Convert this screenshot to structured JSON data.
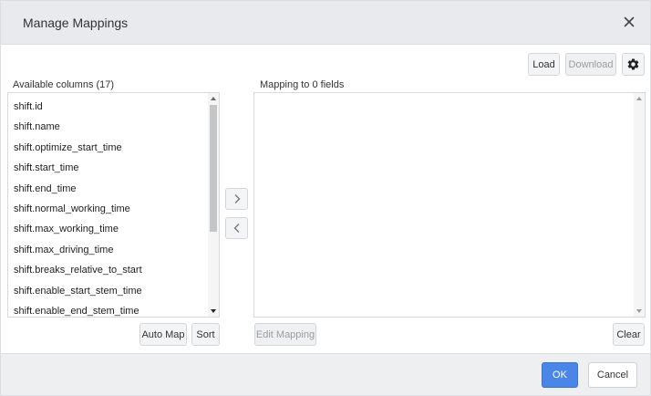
{
  "dialog": {
    "title": "Manage Mappings",
    "close_icon": "close-icon"
  },
  "toolbar": {
    "load_label": "Load",
    "download_label": "Download",
    "settings_icon": "gear-icon"
  },
  "available": {
    "label": "Available columns (17)",
    "items": [
      "shift.id",
      "shift.name",
      "shift.optimize_start_time",
      "shift.start_time",
      "shift.end_time",
      "shift.normal_working_time",
      "shift.max_working_time",
      "shift.max_driving_time",
      "shift.breaks_relative_to_start",
      "shift.enable_start_stem_time",
      "shift.enable_end_stem_time"
    ],
    "auto_map_label": "Auto Map",
    "sort_label": "Sort"
  },
  "transfer": {
    "add_icon": "chevron-right-icon",
    "remove_icon": "chevron-left-icon"
  },
  "mapping": {
    "label": "Mapping to 0 fields",
    "edit_label": "Edit Mapping",
    "clear_label": "Clear"
  },
  "footer": {
    "ok_label": "OK",
    "cancel_label": "Cancel"
  },
  "colors": {
    "primary": "#4a86e8",
    "header_bg": "#e9eaed",
    "footer_bg": "#eeeff1"
  }
}
